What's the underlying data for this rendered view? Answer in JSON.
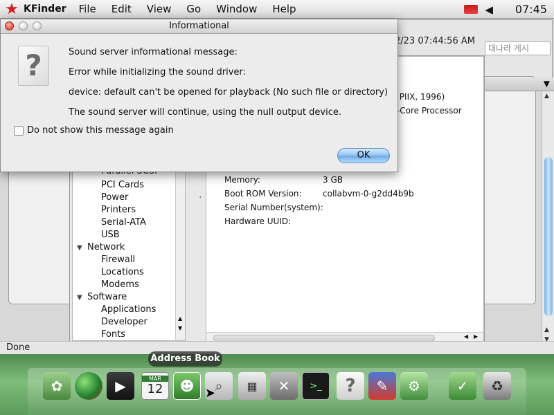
{
  "menubar": {
    "app_name": "KFinder",
    "items": [
      "File",
      "Edit",
      "View",
      "Go",
      "Window",
      "Help"
    ],
    "clock": "07:45"
  },
  "background": {
    "date_text": "2/23 07:44:56 AM",
    "search_field_text": "대나라 게시"
  },
  "sysinfo": {
    "tree": [
      {
        "label": "Parallel SCSI"
      },
      {
        "label": "PCI Cards"
      },
      {
        "label": "Power"
      },
      {
        "label": "Printers"
      },
      {
        "label": "Serial-ATA"
      },
      {
        "label": "USB"
      },
      {
        "label": "Network"
      },
      {
        "label": "Firewall"
      },
      {
        "label": "Locations"
      },
      {
        "label": "Modems"
      },
      {
        "label": "Software"
      },
      {
        "label": "Applications"
      },
      {
        "label": "Developer"
      },
      {
        "label": "Fonts"
      }
    ],
    "partial_lines": [
      "FX + PIIX, 1996)",
      "DX 8-Core Processor"
    ],
    "details": [
      {
        "key": "Memory:",
        "value": "3 GB"
      },
      {
        "key": "Boot ROM Version:",
        "value": "collabvm-0-g2dd4b9b"
      },
      {
        "key": "Serial Number(system):",
        "value": ""
      },
      {
        "key": "Hardware UUID:",
        "value": ""
      }
    ],
    "status": "Done"
  },
  "dialog": {
    "title": "Informational",
    "lines": [
      "Sound server informational message:",
      "Error while initializing the sound driver:",
      "device: default can't be opened for playback (No such file or directory)",
      "The sound server will continue, using the null output device."
    ],
    "checkbox_label": "Do not show this message again",
    "ok_label": "OK"
  },
  "dock": {
    "tooltip": "Address Book",
    "calendar_month": "MAR",
    "calendar_day": "12",
    "items": [
      "photos-icon",
      "globe-icon",
      "movie-icon",
      "calendar-icon",
      "address-book-icon",
      "preview-icon",
      "calculator-icon",
      "system-tools-icon",
      "terminal-icon",
      "help-icon",
      "dictionary-icon",
      "network-icon",
      "file-manager-icon",
      "trash-icon"
    ]
  },
  "colors": {
    "accent": "#6aa9e6",
    "dock_green": "#6fae6c",
    "star_red": "#d51a1a"
  }
}
